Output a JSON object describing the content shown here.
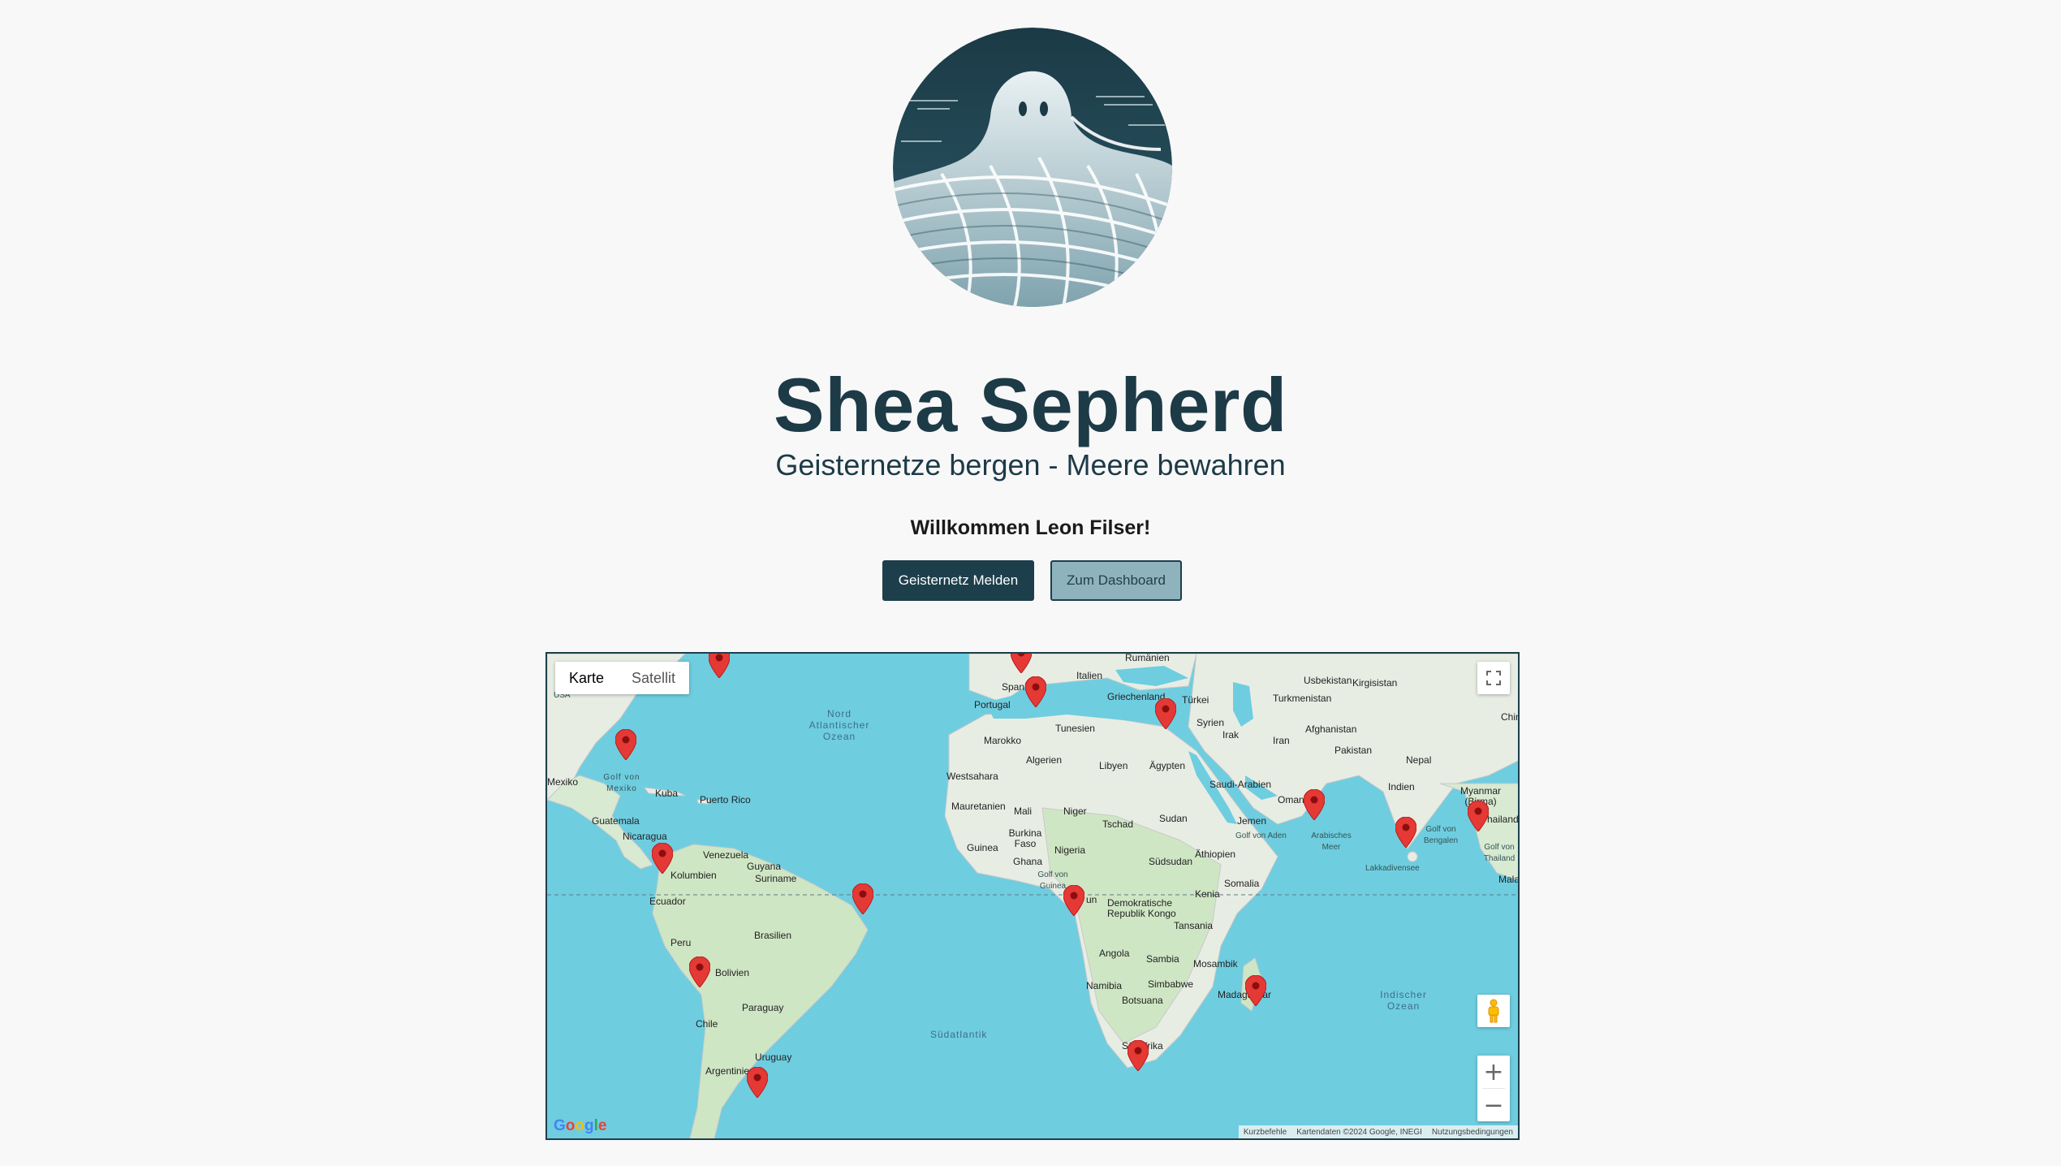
{
  "header": {
    "title": "Shea Sepherd",
    "subtitle": "Geisternetze bergen - Meere bewahren",
    "welcome": "Willkommen Leon Filser!"
  },
  "actions": {
    "report_label": "Geisternetz Melden",
    "dashboard_label": "Zum Dashboard"
  },
  "map": {
    "type_tabs": [
      "Karte",
      "Satellit"
    ],
    "active_tab": "Karte",
    "attribution": [
      "Kurzbefehle",
      "Kartendaten ©2024 Google, INEGI",
      "Nutzungsbedingungen"
    ],
    "logo_text": "Google",
    "marker_color": "#e53935",
    "marker_count": 16,
    "labels": {
      "usa": "USA",
      "mexiko": "Mexiko",
      "golf_mexiko": "Golf von Mexiko",
      "kuba": "Kuba",
      "puerto_rico": "Puerto Rico",
      "guatemala": "Guatemala",
      "nicaragua": "Nicaragua",
      "venezuela": "Venezuela",
      "guyana": "Guyana",
      "suriname": "Suriname",
      "kolumbien": "Kolumbien",
      "ecuador": "Ecuador",
      "peru": "Peru",
      "brasilien": "Brasilien",
      "bolivien": "Bolivien",
      "paraguay": "Paraguay",
      "chile": "Chile",
      "uruguay": "Uruguay",
      "argentinien": "Argentinien",
      "nordatlantik": "Nord Atlantischer Ozean",
      "suedatlantik": "Südatlantik",
      "indischer": "Indischer Ozean",
      "spanien": "Spani",
      "portugal": "Portugal",
      "italien": "Italien",
      "rumaenien": "Rumänien",
      "griechenland": "Griechenland",
      "tuerkei": "Türkei",
      "tunesien": "Tunesien",
      "marokko": "Marokko",
      "algerien": "Algerien",
      "libyen": "Libyen",
      "aegypten": "Ägypten",
      "syrien": "Syrien",
      "irak": "Irak",
      "iran": "Iran",
      "usbekistan": "Usbekistan",
      "kirgisistan": "Kirgisistan",
      "turkmenistan": "Turkmenistan",
      "afghanistan": "Afghanistan",
      "pakistan": "Pakistan",
      "nepal": "Nepal",
      "china": "Chin",
      "indien": "Indien",
      "myanmar": "Myanmar (Birma)",
      "thailand": "hailand",
      "golf_bengalen": "Golf von Bengalen",
      "golf_thailand": "Golf von Thailand",
      "malaysia": "Malay",
      "lakkadivensee": "Lakkadivensee",
      "arabisches_meer": "Arabisches Meer",
      "golf_aden": "Golf von Aden",
      "westsahara": "Westsahara",
      "mauretanien": "Mauretanien",
      "mali": "Mali",
      "niger": "Niger",
      "tschad": "Tschad",
      "sudan": "Sudan",
      "saudi": "Saudi-Arabien",
      "oman": "Oman",
      "jemen": "Jemen",
      "burkina": "Burkina Faso",
      "guinea": "Guinea",
      "ghana": "Ghana",
      "nigeria": "Nigeria",
      "suedsudan": "Südsudan",
      "aethiopien": "Äthiopien",
      "somalia": "Somalia",
      "golf_guinea": "Golf von Guinea",
      "kamerun": "un",
      "kongo": "Demokratische Republik Kongo",
      "kenia": "Kenia",
      "tansania": "Tansania",
      "angola": "Angola",
      "sambia": "Sambia",
      "mosambik": "Mosambik",
      "namibia": "Namibia",
      "simbabwe": "Simbabwe",
      "botsuana": "Botsuana",
      "madagaskar": "Madagaskar",
      "suedafrika": "Südafrika"
    }
  }
}
